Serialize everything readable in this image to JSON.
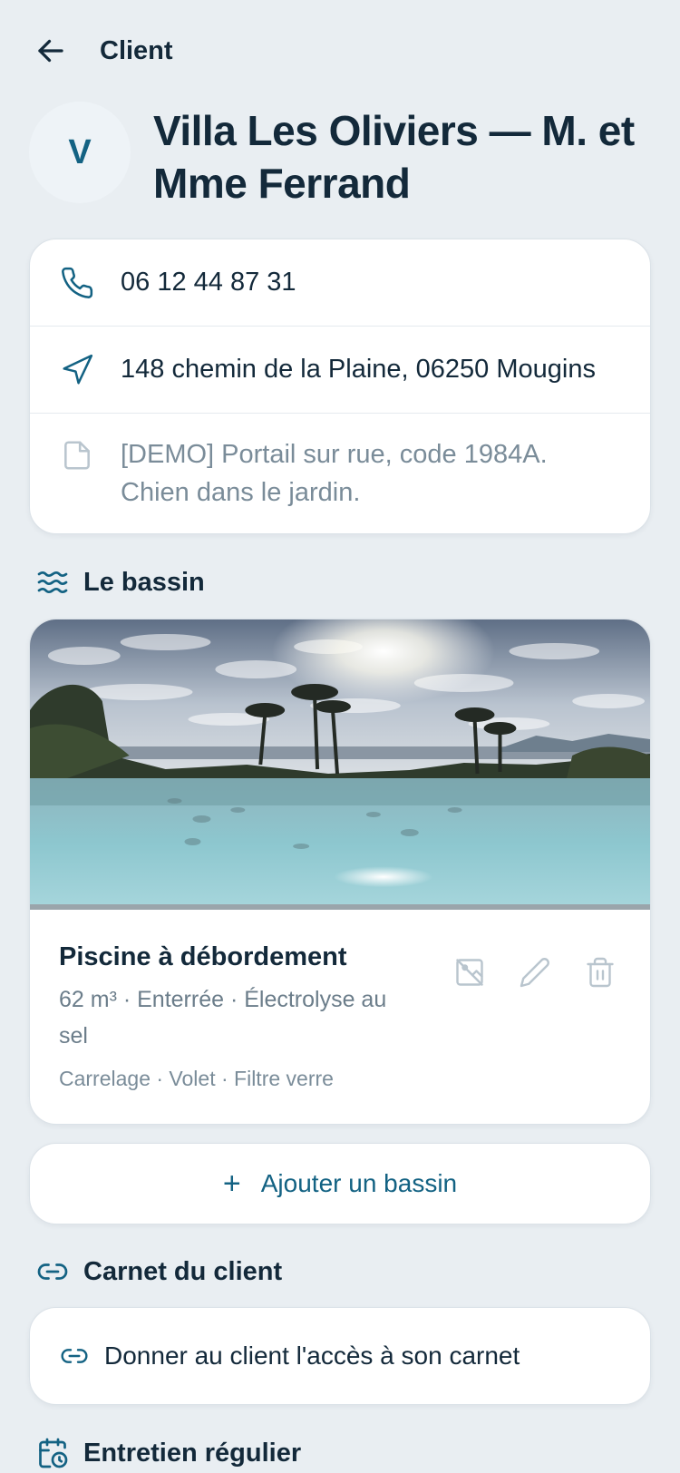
{
  "header": {
    "title": "Client",
    "back_icon": "arrow-left-icon"
  },
  "client": {
    "initial": "V",
    "name": "Villa Les Oliviers — M. et Mme Ferrand"
  },
  "contact": {
    "phone": "06 12 44 87 31",
    "address": "148 chemin de la Plaine, 06250 Mougins",
    "note": "[DEMO] Portail sur rue, code 1984A. Chien dans le jardin."
  },
  "pool_section": {
    "title": "Le bassin",
    "icon": "waves-icon"
  },
  "pool": {
    "name": "Piscine à débordement",
    "specs": "62 m³ · Enterrée · Électrolyse au sel",
    "extras": "Carrelage · Volet · Filtre verre",
    "actions": [
      "no-photo-icon",
      "pencil-icon",
      "trash-icon"
    ]
  },
  "add_pool": {
    "label": "Ajouter un bassin",
    "icon": "plus-icon"
  },
  "notebook_section": {
    "title": "Carnet du client",
    "icon": "link-icon"
  },
  "notebook_access": {
    "label": "Donner au client l'accès à son carnet",
    "icon": "link-icon"
  },
  "maintenance_section": {
    "title": "Entretien régulier",
    "icon": "calendar-clock-icon"
  },
  "colors": {
    "accent": "#136283",
    "text": "#13293a",
    "muted": "#7a8c99",
    "background": "#e9eef2",
    "card": "#ffffff"
  }
}
